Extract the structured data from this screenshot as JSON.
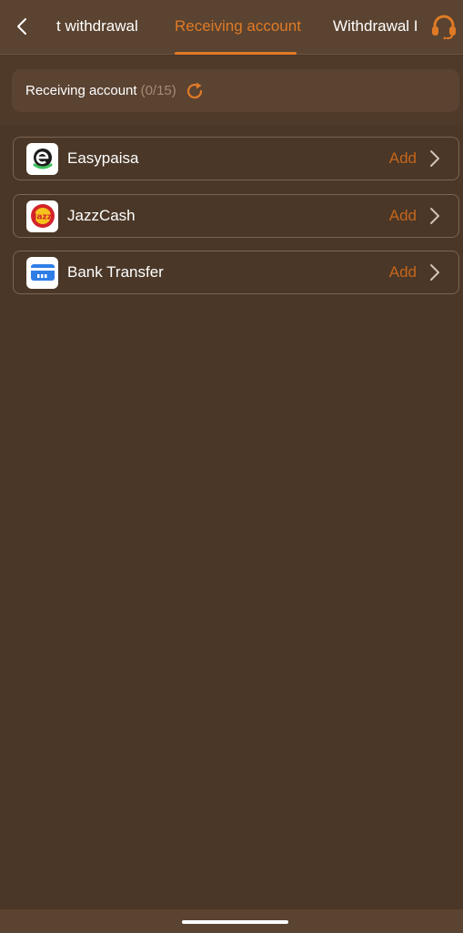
{
  "header": {
    "tabs": [
      {
        "label": "t withdrawal",
        "active": false
      },
      {
        "label": "Receiving account",
        "active": true
      },
      {
        "label": "Withdrawal I",
        "active": false
      }
    ]
  },
  "summary": {
    "label": "Receiving account",
    "count": "(0/15)"
  },
  "accounts": [
    {
      "name": "Easypaisa",
      "action": "Add"
    },
    {
      "name": "JazzCash",
      "action": "Add"
    },
    {
      "name": "Bank Transfer",
      "action": "Add"
    }
  ],
  "colors": {
    "accent": "#e07a26",
    "background": "#4a3727",
    "header": "#5a4330"
  },
  "icons": {
    "back": "chevron-left-icon",
    "support": "headset-icon",
    "refresh": "refresh-icon",
    "row": "chevron-right-icon"
  }
}
